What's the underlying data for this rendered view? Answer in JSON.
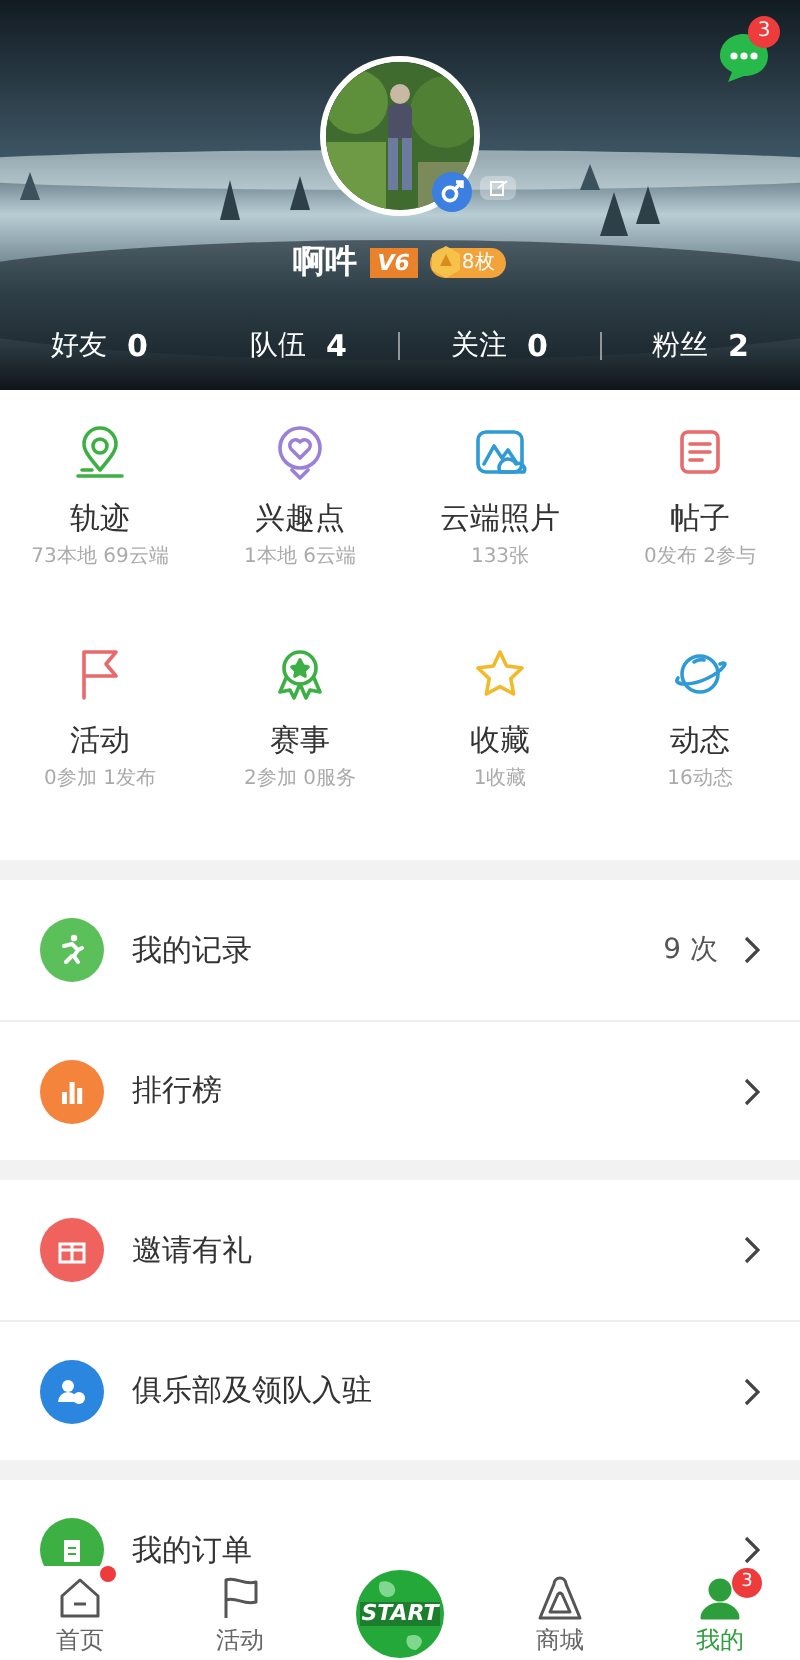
{
  "message_badge": "3",
  "profile": {
    "name": "啊吽",
    "level": "V6",
    "medal_count": "8枚"
  },
  "stats": [
    {
      "label": "好友",
      "value": "0"
    },
    {
      "label": "队伍",
      "value": "4"
    },
    {
      "label": "关注",
      "value": "0"
    },
    {
      "label": "粉丝",
      "value": "2"
    }
  ],
  "grid": [
    {
      "title": "轨迹",
      "subtitle": "73本地 69云端"
    },
    {
      "title": "兴趣点",
      "subtitle": "1本地 6云端"
    },
    {
      "title": "云端照片",
      "subtitle": "133张"
    },
    {
      "title": "帖子",
      "subtitle": "0发布 2参与"
    },
    {
      "title": "活动",
      "subtitle": "0参加 1发布"
    },
    {
      "title": "赛事",
      "subtitle": "2参加 0服务"
    },
    {
      "title": "收藏",
      "subtitle": "1收藏"
    },
    {
      "title": "动态",
      "subtitle": "16动态"
    }
  ],
  "menu_groups": [
    [
      {
        "label": "我的记录",
        "value": "9 次"
      },
      {
        "label": "排行榜"
      }
    ],
    [
      {
        "label": "邀请有礼"
      },
      {
        "label": "俱乐部及领队入驻"
      }
    ],
    [
      {
        "label": "我的订单"
      }
    ]
  ],
  "tab_bar": [
    {
      "kind": "tab",
      "label": "首页",
      "selected": false,
      "dot": true
    },
    {
      "kind": "tab",
      "label": "活动",
      "selected": false,
      "dot": false
    },
    {
      "kind": "logo",
      "text": "START"
    },
    {
      "kind": "tab",
      "label": "商城",
      "selected": false,
      "dot": false
    },
    {
      "kind": "tab",
      "label": "我的",
      "selected": true,
      "dot": false,
      "badge": "3"
    }
  ]
}
